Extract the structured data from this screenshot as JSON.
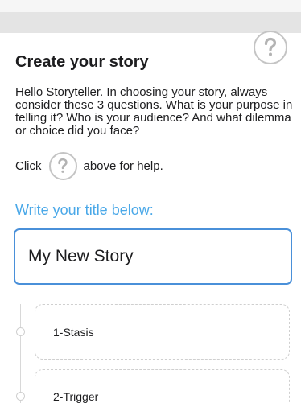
{
  "header": {
    "help_icon": "question-circle-icon"
  },
  "page": {
    "title": "Create your story",
    "intro": "Hello Storyteller. In choosing your story, always consider these 3 questions. What is your purpose in telling it? Who is your audience? And what dilemma or choice did you face?",
    "help_prefix": "Click",
    "help_suffix": "above for help."
  },
  "title_field": {
    "prompt": "Write your title below:",
    "value": "My New Story"
  },
  "stages": [
    {
      "label": "1-Stasis"
    },
    {
      "label": "2-Trigger"
    }
  ],
  "colors": {
    "accent": "#4aa8e8",
    "input_border": "#4a90d9",
    "text": "#1d1d1f",
    "muted_border": "#c4c4c4"
  }
}
